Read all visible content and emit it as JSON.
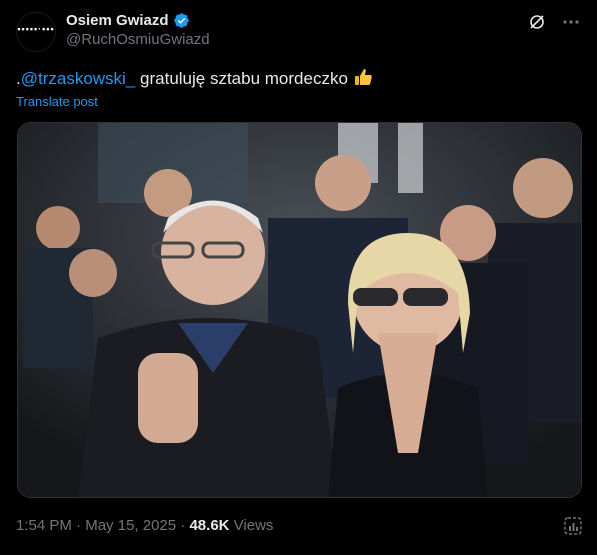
{
  "author": {
    "display_name": "Osiem Gwiazd",
    "handle": "@RuchOsmiuGwiazd",
    "avatar_icon": "eight-stars-logo",
    "verified_color": "#1d9bf0"
  },
  "tweet": {
    "prefix": ".",
    "mention": "@trzaskowski_",
    "text": " gratuluję sztabu mordeczko",
    "emoji_icon": "thumbs-up-icon",
    "translate_label": "Translate post"
  },
  "media": {
    "icon": "photo",
    "description_icon": "crowd-photo"
  },
  "meta": {
    "time": "1:54 PM",
    "separator": " · ",
    "date": "May 15, 2025",
    "views_count": "48.6K",
    "views_label": " Views"
  },
  "colors": {
    "background": "#000000",
    "text": "#e7e9ea",
    "muted": "#71767b",
    "link": "#1d9bf0",
    "border": "#2f3336"
  }
}
